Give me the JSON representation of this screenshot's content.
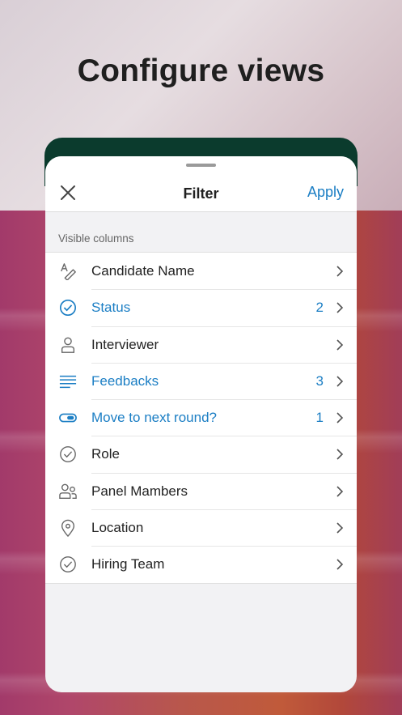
{
  "headline": "Configure views",
  "filter_sheet": {
    "title": "Filter",
    "apply_label": "Apply",
    "section_label": "Visible columns",
    "accent_color": "#1b7ec4",
    "rows": [
      {
        "label": "Candidate Name",
        "count": "",
        "icon": "text-style-icon",
        "active": false
      },
      {
        "label": "Status",
        "count": "2",
        "icon": "circle-check-icon",
        "active": true
      },
      {
        "label": "Interviewer",
        "count": "",
        "icon": "person-icon",
        "active": false
      },
      {
        "label": "Feedbacks",
        "count": "3",
        "icon": "text-lines-icon",
        "active": true
      },
      {
        "label": "Move to next round?",
        "count": "1",
        "icon": "toggle-icon",
        "active": true
      },
      {
        "label": "Role",
        "count": "",
        "icon": "circle-check-icon",
        "active": false
      },
      {
        "label": "Panel Mambers",
        "count": "",
        "icon": "people-icon",
        "active": false
      },
      {
        "label": "Location",
        "count": "",
        "icon": "location-pin-icon",
        "active": false
      },
      {
        "label": "Hiring Team",
        "count": "",
        "icon": "circle-check-icon",
        "active": false
      }
    ]
  }
}
